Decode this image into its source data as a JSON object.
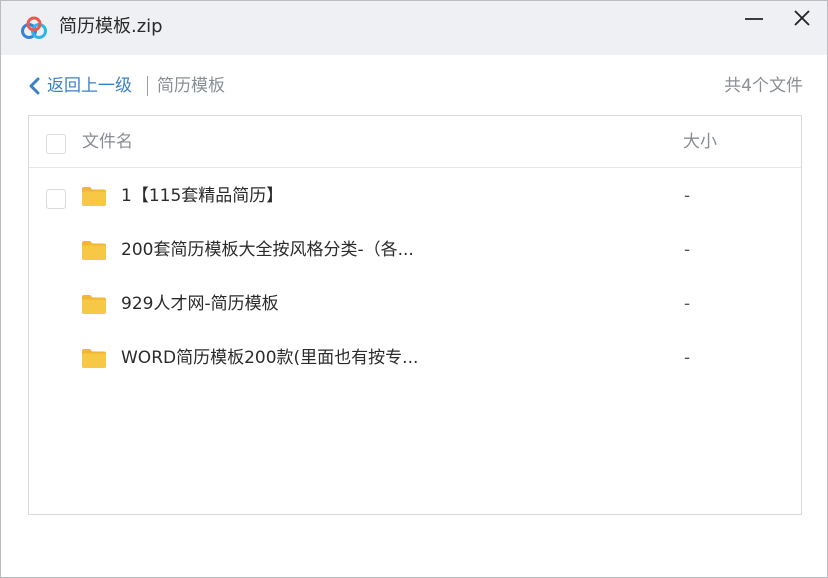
{
  "window": {
    "title": "简历模板.zip"
  },
  "nav": {
    "back_label": "返回上一级",
    "separator": "|",
    "breadcrumb": "简历模板",
    "file_count": "共4个文件"
  },
  "list": {
    "header": {
      "name": "文件名",
      "size": "大小"
    },
    "rows": [
      {
        "name": "1【115套精品简历】",
        "size": "-"
      },
      {
        "name": "200套简历模板大全按风格分类-（各...",
        "size": "-"
      },
      {
        "name": "929人才网-简历模板",
        "size": "-"
      },
      {
        "name": "WORD简历模板200款(里面也有按专...",
        "size": "-"
      }
    ]
  },
  "colors": {
    "accent": "#3a82c8",
    "folder": "#f7c845",
    "titlebar": "#eef0f3"
  },
  "icons": {
    "app": "baidu-netdisk-logo",
    "minimize": "minimize-icon",
    "close": "close-icon",
    "back": "chevron-left-icon",
    "folder": "folder-icon"
  }
}
